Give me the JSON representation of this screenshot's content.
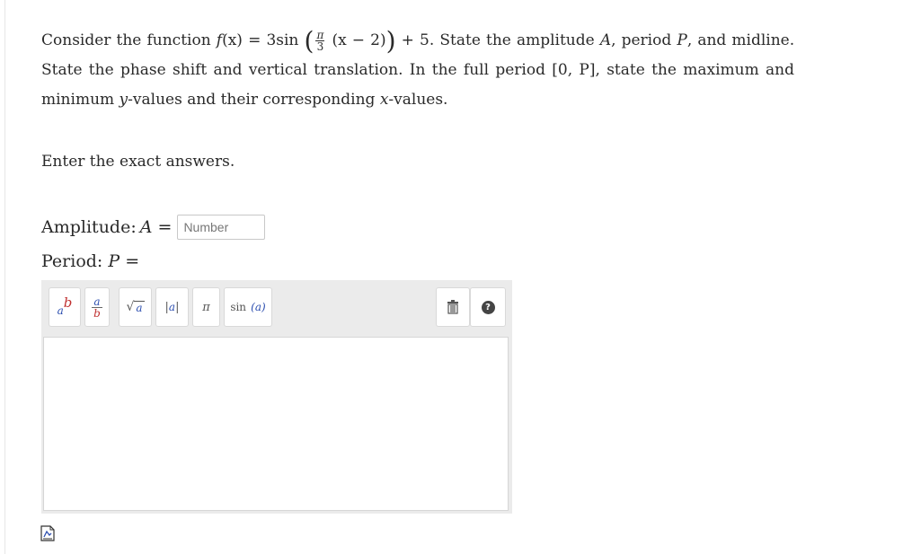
{
  "question": {
    "intro": "Consider the function",
    "func_name": "f",
    "func_arg": "(x)",
    "equals": "=",
    "coefficient": "3",
    "trig": "sin",
    "frac_num": "π",
    "frac_den": "3",
    "inner": "(x − 2)",
    "plus_const": "+ 5.",
    "ask_1": "State the amplitude",
    "var_A": "A",
    "sep_1": ", period",
    "var_P": "P",
    "sep_2": ", and midline. State the phase shift and vertical translation. In the full period",
    "interval": "[0, P]",
    "ask_2": ", state the maximum and minimum",
    "var_y": "y",
    "ask_3": "-values and their corresponding",
    "var_x": "x",
    "ask_4": "-values."
  },
  "instructions": "Enter the exact answers.",
  "amplitude": {
    "label": "Amplitude:",
    "var": "A",
    "equals": "=",
    "placeholder": "Number",
    "value": ""
  },
  "period": {
    "label": "Period:",
    "var": "P",
    "equals": "="
  },
  "toolbar": {
    "power": {
      "base": "a",
      "exp": "b"
    },
    "fraction": {
      "num": "a",
      "den": "b"
    },
    "sqrt": {
      "radical": "√",
      "arg": "a"
    },
    "abs": {
      "bar": "|",
      "arg": "a"
    },
    "pi": "π",
    "sin": {
      "fn": "sin",
      "arg": "(a)"
    },
    "trash_icon": "trash-icon",
    "help": "?"
  },
  "answer_value": "",
  "colors": {
    "toolbar_bg": "#ebebeb",
    "var_blue": "#2d4fb0",
    "var_red": "#c03030"
  }
}
